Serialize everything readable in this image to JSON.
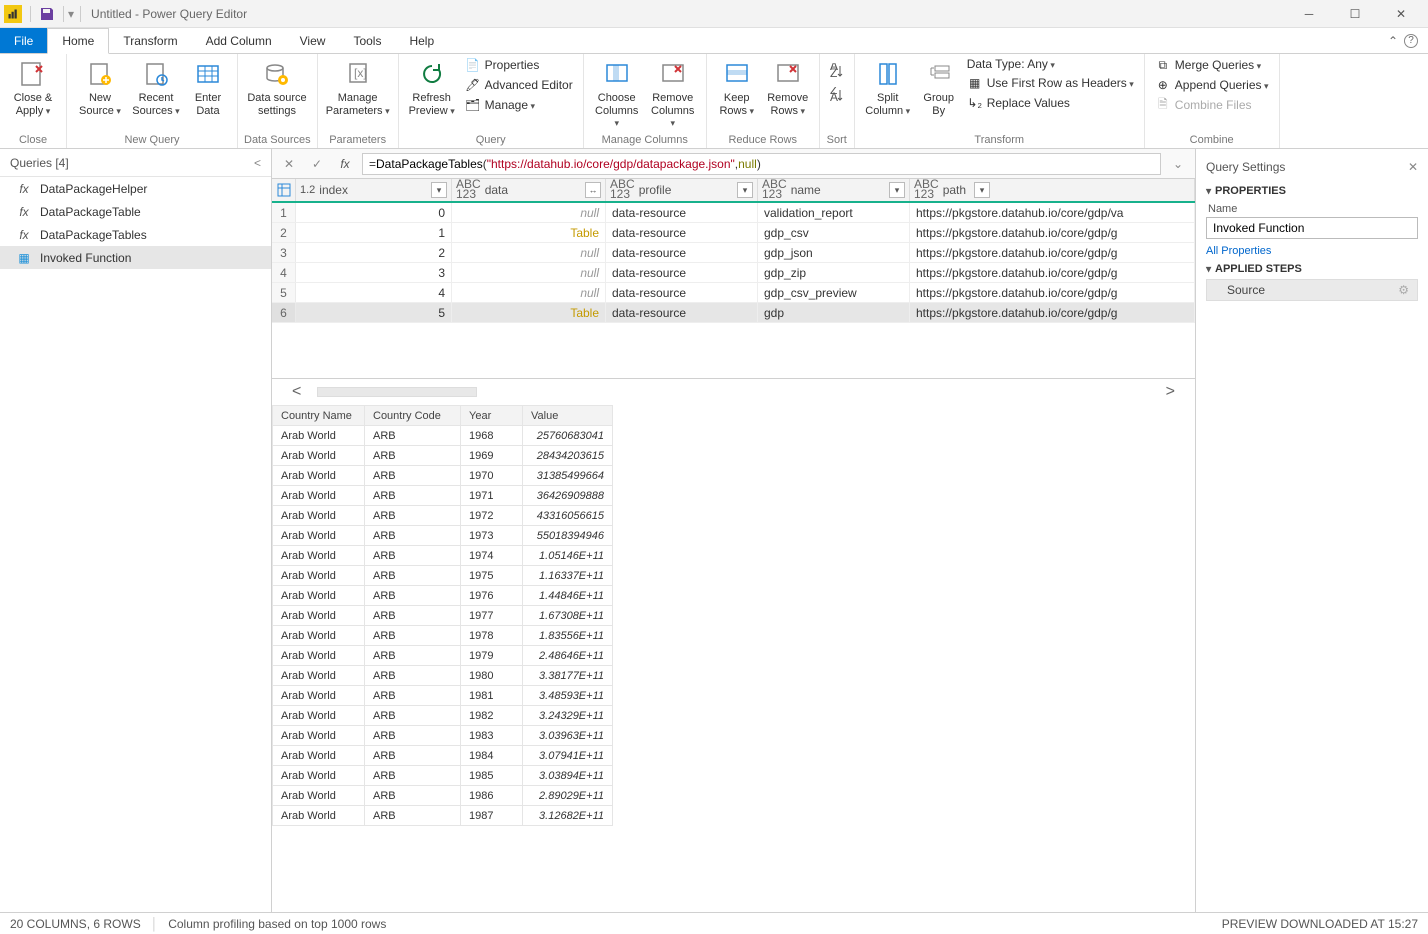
{
  "window": {
    "title": "Untitled - Power Query Editor"
  },
  "ribbon": {
    "tabs": [
      "File",
      "Home",
      "Transform",
      "Add Column",
      "View",
      "Tools",
      "Help"
    ],
    "active": "Home",
    "groups": {
      "close": {
        "label": "Close",
        "close_apply": "Close &\nApply"
      },
      "newquery": {
        "label": "New Query",
        "new_source": "New\nSource",
        "recent_sources": "Recent\nSources",
        "enter_data": "Enter\nData"
      },
      "datasources": {
        "label": "Data Sources",
        "btn": "Data source\nsettings"
      },
      "parameters": {
        "label": "Parameters",
        "btn": "Manage\nParameters"
      },
      "query": {
        "label": "Query",
        "refresh": "Refresh\nPreview",
        "properties": "Properties",
        "adv_editor": "Advanced Editor",
        "manage": "Manage"
      },
      "managecols": {
        "label": "Manage Columns",
        "choose": "Choose\nColumns",
        "remove": "Remove\nColumns"
      },
      "reducerows": {
        "label": "Reduce Rows",
        "keep": "Keep\nRows",
        "remove": "Remove\nRows"
      },
      "sort": {
        "label": "Sort"
      },
      "transform": {
        "label": "Transform",
        "split": "Split\nColumn",
        "group": "Group\nBy",
        "datatype": "Data Type: Any",
        "first_row": "Use First Row as Headers",
        "replace": "Replace Values"
      },
      "combine": {
        "label": "Combine",
        "merge": "Merge Queries",
        "append": "Append Queries",
        "files": "Combine Files"
      }
    }
  },
  "queries": {
    "header": "Queries [4]",
    "items": [
      {
        "name": "DataPackageHelper",
        "type": "fx"
      },
      {
        "name": "DataPackageTable",
        "type": "fx"
      },
      {
        "name": "DataPackageTables",
        "type": "fx"
      },
      {
        "name": "Invoked Function",
        "type": "table",
        "selected": true
      }
    ]
  },
  "formula": {
    "prefix": "= ",
    "fn": "DataPackageTables",
    "open": "(",
    "str": "\"https://datahub.io/core/gdp/datapackage.json\"",
    "comma": ", ",
    "null": "null",
    "close": ")"
  },
  "grid": {
    "columns": [
      {
        "key": "index",
        "label": "index",
        "type": "1.2"
      },
      {
        "key": "data",
        "label": "data",
        "type": "ABC123"
      },
      {
        "key": "profile",
        "label": "profile",
        "type": "ABC123"
      },
      {
        "key": "name",
        "label": "name",
        "type": "ABC123"
      },
      {
        "key": "path",
        "label": "path",
        "type": "ABC123"
      }
    ],
    "rows": [
      {
        "n": 1,
        "index": "0",
        "data": "null",
        "profile": "data-resource",
        "name": "validation_report",
        "path": "https://pkgstore.datahub.io/core/gdp/va"
      },
      {
        "n": 2,
        "index": "1",
        "data": "Table",
        "profile": "data-resource",
        "name": "gdp_csv",
        "path": "https://pkgstore.datahub.io/core/gdp/g"
      },
      {
        "n": 3,
        "index": "2",
        "data": "null",
        "profile": "data-resource",
        "name": "gdp_json",
        "path": "https://pkgstore.datahub.io/core/gdp/g"
      },
      {
        "n": 4,
        "index": "3",
        "data": "null",
        "profile": "data-resource",
        "name": "gdp_zip",
        "path": "https://pkgstore.datahub.io/core/gdp/g"
      },
      {
        "n": 5,
        "index": "4",
        "data": "null",
        "profile": "data-resource",
        "name": "gdp_csv_preview",
        "path": "https://pkgstore.datahub.io/core/gdp/g"
      },
      {
        "n": 6,
        "index": "5",
        "data": "Table",
        "profile": "data-resource",
        "name": "gdp",
        "path": "https://pkgstore.datahub.io/core/gdp/g",
        "selected": true
      }
    ]
  },
  "preview": {
    "headers": [
      "Country Name",
      "Country Code",
      "Year",
      "Value"
    ],
    "rows": [
      [
        "Arab World",
        "ARB",
        "1968",
        "25760683041"
      ],
      [
        "Arab World",
        "ARB",
        "1969",
        "28434203615"
      ],
      [
        "Arab World",
        "ARB",
        "1970",
        "31385499664"
      ],
      [
        "Arab World",
        "ARB",
        "1971",
        "36426909888"
      ],
      [
        "Arab World",
        "ARB",
        "1972",
        "43316056615"
      ],
      [
        "Arab World",
        "ARB",
        "1973",
        "55018394946"
      ],
      [
        "Arab World",
        "ARB",
        "1974",
        "1.05146E+11"
      ],
      [
        "Arab World",
        "ARB",
        "1975",
        "1.16337E+11"
      ],
      [
        "Arab World",
        "ARB",
        "1976",
        "1.44846E+11"
      ],
      [
        "Arab World",
        "ARB",
        "1977",
        "1.67308E+11"
      ],
      [
        "Arab World",
        "ARB",
        "1978",
        "1.83556E+11"
      ],
      [
        "Arab World",
        "ARB",
        "1979",
        "2.48646E+11"
      ],
      [
        "Arab World",
        "ARB",
        "1980",
        "3.38177E+11"
      ],
      [
        "Arab World",
        "ARB",
        "1981",
        "3.48593E+11"
      ],
      [
        "Arab World",
        "ARB",
        "1982",
        "3.24329E+11"
      ],
      [
        "Arab World",
        "ARB",
        "1983",
        "3.03963E+11"
      ],
      [
        "Arab World",
        "ARB",
        "1984",
        "3.07941E+11"
      ],
      [
        "Arab World",
        "ARB",
        "1985",
        "3.03894E+11"
      ],
      [
        "Arab World",
        "ARB",
        "1986",
        "2.89029E+11"
      ],
      [
        "Arab World",
        "ARB",
        "1987",
        "3.12682E+11"
      ]
    ]
  },
  "settings": {
    "header": "Query Settings",
    "properties": "PROPERTIES",
    "name_label": "Name",
    "name_value": "Invoked Function",
    "all_props": "All Properties",
    "applied_steps": "APPLIED STEPS",
    "step": "Source"
  },
  "status": {
    "left1": "20 COLUMNS, 6 ROWS",
    "left2": "Column profiling based on top 1000 rows",
    "right": "PREVIEW DOWNLOADED AT 15:27"
  }
}
